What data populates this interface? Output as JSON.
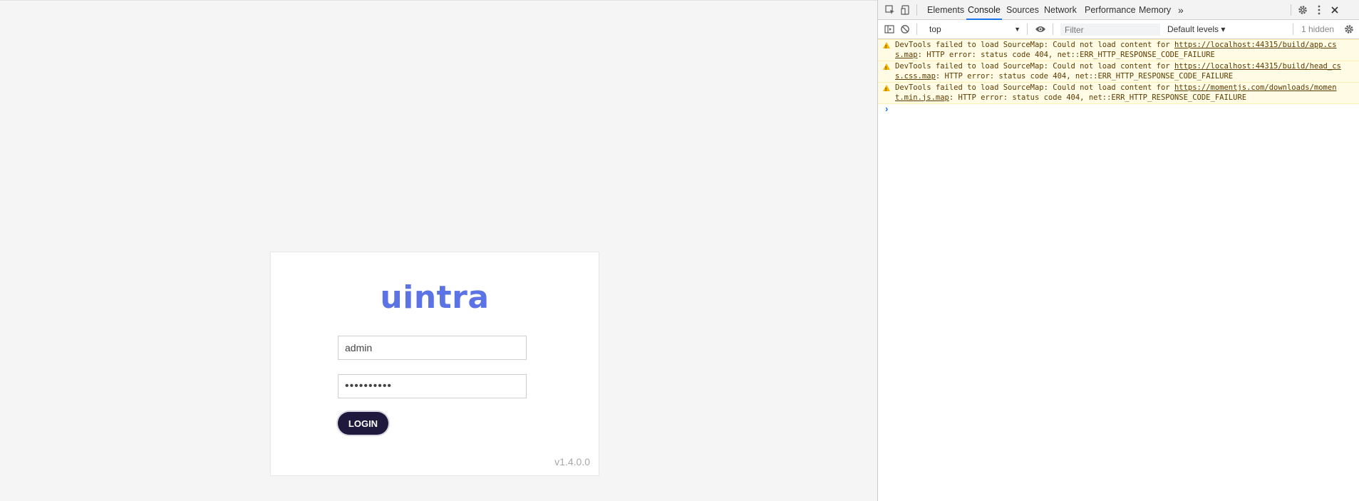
{
  "login": {
    "logo_text": "uintra",
    "username_value": "admin",
    "password_value": "••••••••••",
    "login_label": "LOGIN",
    "version": "v1.4.0.0"
  },
  "devtools": {
    "tabs": [
      "Elements",
      "Console",
      "Sources",
      "Network",
      "Performance",
      "Memory"
    ],
    "active_tab": "Console",
    "more_tabs_glyph": "»",
    "context": "top",
    "filter_placeholder": "Filter",
    "levels_label": "Default levels ▾",
    "hidden_count": "1 hidden",
    "messages": [
      {
        "prefix": "DevTools failed to load SourceMap: Could not load content for ",
        "url": "https://localhost:44315/build/app.css.map",
        "suffix": ": HTTP error: status code 404, net::ERR_HTTP_RESPONSE_CODE_FAILURE"
      },
      {
        "prefix": "DevTools failed to load SourceMap: Could not load content for ",
        "url": "https://localhost:44315/build/head_css.css.map",
        "suffix": ": HTTP error: status code 404, net::ERR_HTTP_RESPONSE_CODE_FAILURE"
      },
      {
        "prefix": "DevTools failed to load SourceMap: Could not load content for ",
        "url": "https://momentjs.com/downloads/moment.min.js.map",
        "suffix": ": HTTP error: status code 404, net::ERR_HTTP_RESPONSE_CODE_FAILURE"
      }
    ],
    "prompt_glyph": "›",
    "colors": {
      "active_tab": "#1a73e8",
      "warning_bg": "#fffbe5",
      "warning_text": "#5c3c00"
    }
  }
}
